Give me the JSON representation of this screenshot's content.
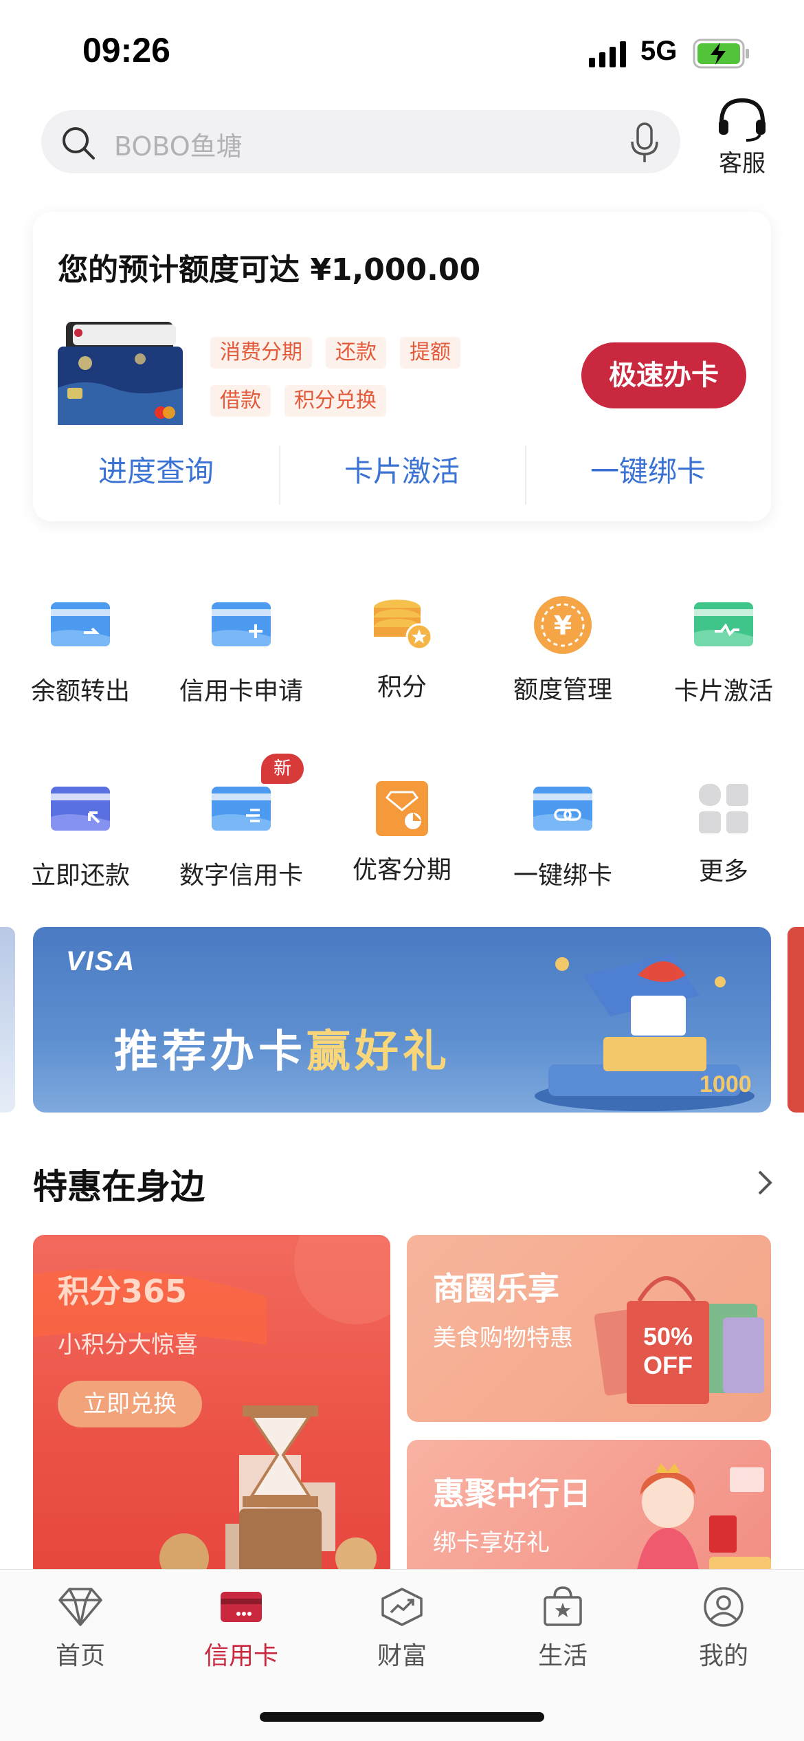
{
  "status_bar": {
    "time": "09:26",
    "network": "5G"
  },
  "search": {
    "placeholder": "BOBO鱼塘"
  },
  "header": {
    "service_label": "客服"
  },
  "credit_panel": {
    "title": "您的预计额度可达 ¥1,000.00",
    "tags": [
      "消费分期",
      "还款",
      "提额",
      "借款",
      "积分兑换"
    ],
    "apply_button": "极速办卡",
    "links": [
      "进度查询",
      "卡片激活",
      "一键绑卡"
    ]
  },
  "grid": {
    "row1": [
      "余额转出",
      "信用卡申请",
      "积分",
      "额度管理",
      "卡片激活"
    ],
    "row2": [
      "立即还款",
      "数字信用卡",
      "优客分期",
      "一键绑卡",
      "更多"
    ],
    "new_badge": "新"
  },
  "banner": {
    "brand": "VISA",
    "text_main": "推荐办卡",
    "text_highlight": "赢好礼"
  },
  "section": {
    "title": "特惠在身边"
  },
  "promos": {
    "big": {
      "title": "积分365",
      "subtitle": "小积分大惊喜",
      "button": "立即兑换"
    },
    "right_top": {
      "title": "商圈乐享",
      "subtitle": "美食购物特惠",
      "sale_line1": "50%",
      "sale_line2": "OFF"
    },
    "right_bottom": {
      "title": "惠聚中行日",
      "subtitle": "绑卡享好礼"
    }
  },
  "tabbar": {
    "items": [
      "首页",
      "信用卡",
      "财富",
      "生活",
      "我的"
    ],
    "active_index": 1,
    "active_color": "#c9283e"
  }
}
